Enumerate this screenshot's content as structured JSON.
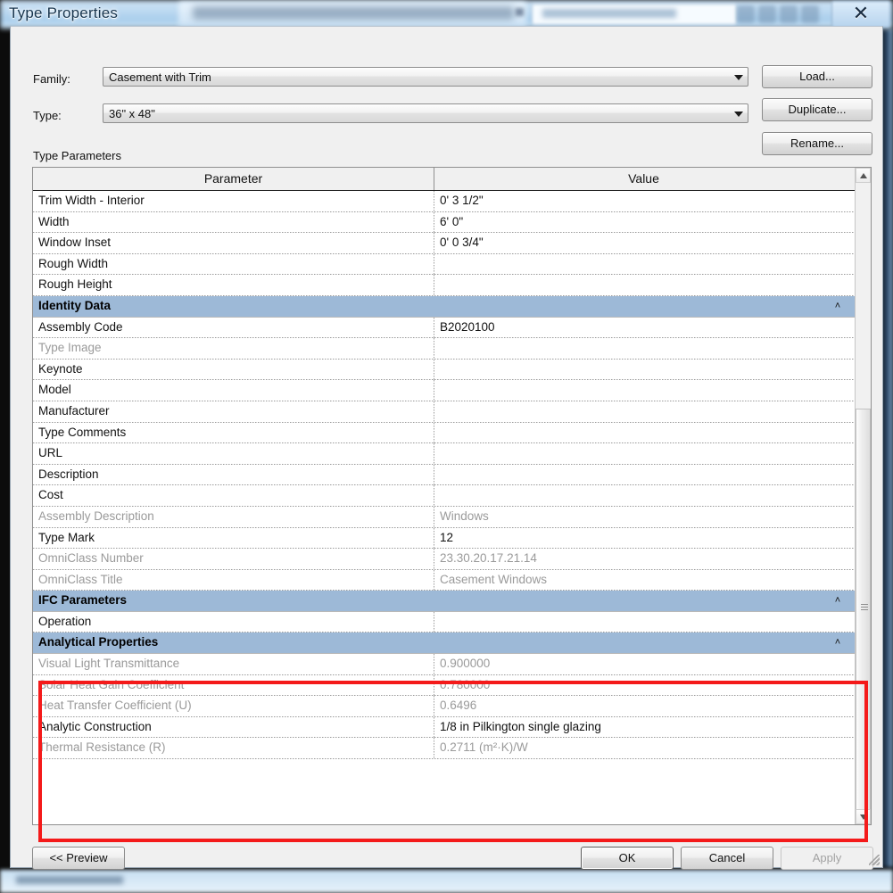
{
  "window": {
    "title": "Type Properties",
    "close_icon": "close-x-icon"
  },
  "background": {
    "close_glyph": "✕"
  },
  "form": {
    "family_label": "Family:",
    "family_value": "Casement with Trim",
    "type_label": "Type:",
    "type_value": "36\" x 48\"",
    "dropdown_icon": "chevron-down-icon",
    "load_button": "Load...",
    "duplicate_button": "Duplicate...",
    "rename_button": "Rename..."
  },
  "table": {
    "caption": "Type Parameters",
    "columns": [
      "Parameter",
      "Value"
    ],
    "collapse_icon": "˄",
    "rows": [
      {
        "kind": "row",
        "name": "Trim Width - Interior",
        "value": "0'  3 1/2\"",
        "disabled": false
      },
      {
        "kind": "row",
        "name": "Width",
        "value": "6'  0\"",
        "disabled": false
      },
      {
        "kind": "row",
        "name": "Window Inset",
        "value": "0'  0 3/4\"",
        "disabled": false
      },
      {
        "kind": "row",
        "name": "Rough Width",
        "value": "",
        "disabled": false
      },
      {
        "kind": "row",
        "name": "Rough Height",
        "value": "",
        "disabled": false
      },
      {
        "kind": "section",
        "name": "Identity Data",
        "value": "",
        "disabled": false
      },
      {
        "kind": "row",
        "name": "Assembly Code",
        "value": "B2020100",
        "disabled": false
      },
      {
        "kind": "row",
        "name": "Type Image",
        "value": "",
        "disabled": true
      },
      {
        "kind": "row",
        "name": "Keynote",
        "value": "",
        "disabled": false
      },
      {
        "kind": "row",
        "name": "Model",
        "value": "",
        "disabled": false
      },
      {
        "kind": "row",
        "name": "Manufacturer",
        "value": "",
        "disabled": false
      },
      {
        "kind": "row",
        "name": "Type Comments",
        "value": "",
        "disabled": false
      },
      {
        "kind": "row",
        "name": "URL",
        "value": "",
        "disabled": false
      },
      {
        "kind": "row",
        "name": "Description",
        "value": "",
        "disabled": false
      },
      {
        "kind": "row",
        "name": "Cost",
        "value": "",
        "disabled": false
      },
      {
        "kind": "row",
        "name": "Assembly Description",
        "value": "Windows",
        "disabled": true
      },
      {
        "kind": "row",
        "name": "Type Mark",
        "value": "12",
        "disabled": false
      },
      {
        "kind": "row",
        "name": "OmniClass Number",
        "value": "23.30.20.17.21.14",
        "disabled": true
      },
      {
        "kind": "row",
        "name": "OmniClass Title",
        "value": "Casement Windows",
        "disabled": true
      },
      {
        "kind": "section",
        "name": "IFC Parameters",
        "value": "",
        "disabled": false
      },
      {
        "kind": "row",
        "name": "Operation",
        "value": "",
        "disabled": false
      },
      {
        "kind": "section",
        "name": "Analytical Properties",
        "value": "",
        "disabled": false
      },
      {
        "kind": "row",
        "name": "Visual Light Transmittance",
        "value": "0.900000",
        "disabled": true
      },
      {
        "kind": "row",
        "name": "Solar Heat Gain Coefficient",
        "value": "0.780000",
        "disabled": true
      },
      {
        "kind": "row",
        "name": "Heat Transfer Coefficient (U)",
        "value": "0.6496",
        "disabled": true
      },
      {
        "kind": "row",
        "name": "Analytic Construction",
        "value": "1/8 in Pilkington single glazing",
        "disabled": false
      },
      {
        "kind": "row",
        "name": "Thermal Resistance (R)",
        "value": "0.2711 (m²·K)/W",
        "disabled": true
      }
    ]
  },
  "highlight": {
    "color": "#f41a1a",
    "target_section": "Analytical Properties"
  },
  "footer": {
    "preview_button": "<< Preview",
    "ok_button": "OK",
    "cancel_button": "Cancel",
    "apply_button": "Apply",
    "apply_disabled": true
  },
  "scrollbar": {
    "up_icon": "arrow-up-icon",
    "down_icon": "arrow-down-icon"
  }
}
